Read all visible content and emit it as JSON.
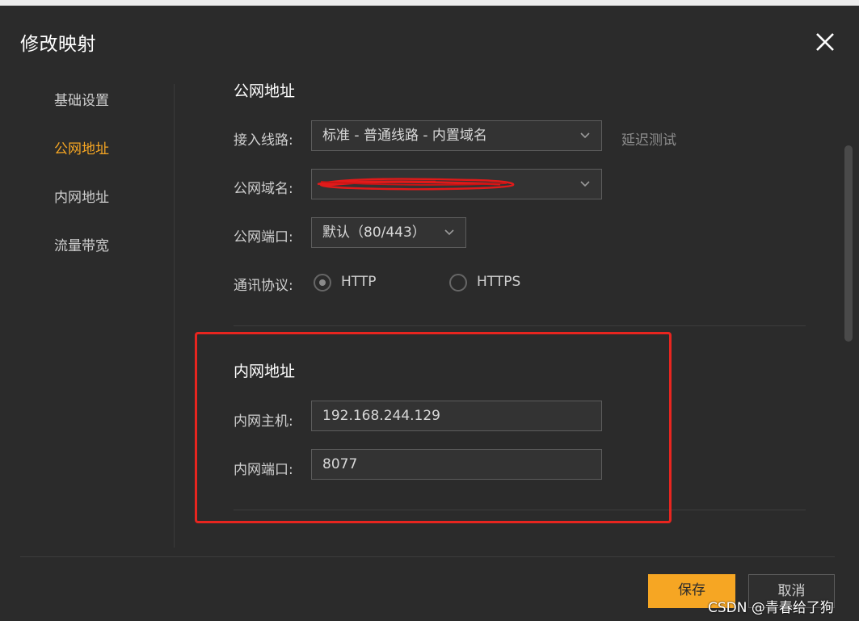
{
  "dialog": {
    "title": "修改映射"
  },
  "sidebar": {
    "items": [
      {
        "label": "基础设置"
      },
      {
        "label": "公网地址"
      },
      {
        "label": "内网地址"
      },
      {
        "label": "流量带宽"
      }
    ],
    "active_index": 1
  },
  "public": {
    "section_title": "公网地址",
    "line_label": "接入线路:",
    "line_value": "标准 - 普通线路 - 内置域名",
    "latency_test": "延迟测试",
    "domain_label": "公网域名:",
    "domain_value": "",
    "port_label": "公网端口:",
    "port_value": "默认（80/443）",
    "protocol_label": "通讯协议:",
    "protocols": [
      {
        "label": "HTTP",
        "selected": true
      },
      {
        "label": "HTTPS",
        "selected": false
      }
    ]
  },
  "internal": {
    "section_title": "内网地址",
    "host_label": "内网主机:",
    "host_value": "192.168.244.129",
    "port_label": "内网端口:",
    "port_value": "8077"
  },
  "footer": {
    "save_label": "保存",
    "cancel_label": "取消"
  },
  "watermark": "CSDN @青春给了狗",
  "colors": {
    "accent": "#f6a623",
    "highlight_border": "#e8251f",
    "background": "#2b2b2b"
  },
  "icons": {
    "close": "close-icon",
    "chevron": "chevron-down-icon"
  }
}
